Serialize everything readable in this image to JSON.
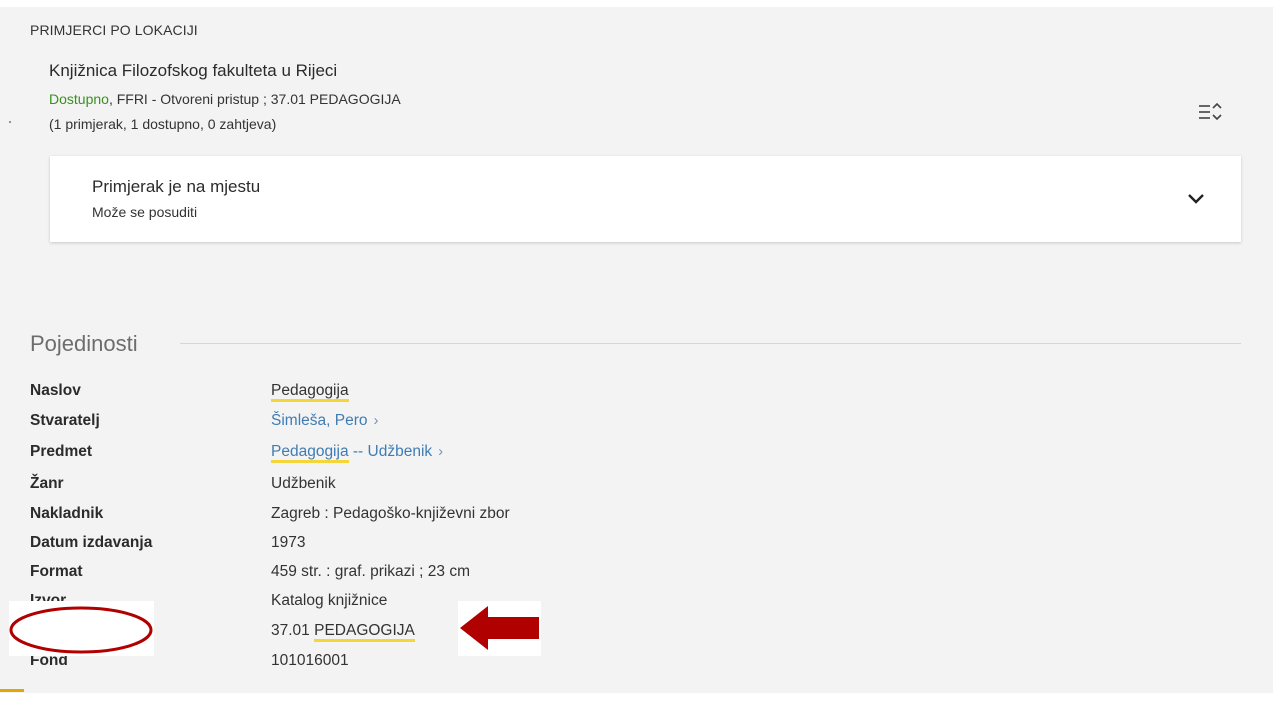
{
  "holdings": {
    "heading": "PRIMJERCI PO LOKACIJI",
    "library_name": "Knjižnica Filozofskog fakulteta u Rijeci",
    "status": "Dostupno",
    "location_rest": ", FFRI - Otvoreni pristup ; 37.01 PEDAGOGIJA",
    "items_summary": "(1 primjerak, 1 dostupno, 0 zahtjeva)",
    "sort_icon": "sort-filter-icon",
    "item": {
      "title": "Primjerak je na mjestu",
      "subtitle": "Može se posuditi",
      "toggle_icon": "chevron-down-icon"
    }
  },
  "details": {
    "title": "Pojedinosti",
    "rows": [
      {
        "label": "Naslov",
        "value": "Pedagogija"
      },
      {
        "label": "Stvaratelj",
        "value": "Šimleša, Pero"
      },
      {
        "label": "Predmet",
        "value_part1": "Pedagogija",
        "value_part2": " -- Udžbenik"
      },
      {
        "label": "Žanr",
        "value": "Udžbenik"
      },
      {
        "label": "Nakladnik",
        "value": "Zagreb : Pedagoško-književni zbor"
      },
      {
        "label": "Datum izdavanja",
        "value": "1973"
      },
      {
        "label": "Format",
        "value": "459 str. : graf. prikazi ; 23 cm"
      },
      {
        "label": "Izvor",
        "value": "Katalog knjižnice"
      },
      {
        "label": "",
        "value_part1": "37.01 ",
        "value_part2": "PEDAGOGIJA"
      },
      {
        "label": "Fond",
        "value": "101016001"
      }
    ]
  },
  "colors": {
    "available": "#3b8f1f",
    "link": "#3f7cb3",
    "highlight": "#f5d63a",
    "annotation_red": "#b00000"
  }
}
